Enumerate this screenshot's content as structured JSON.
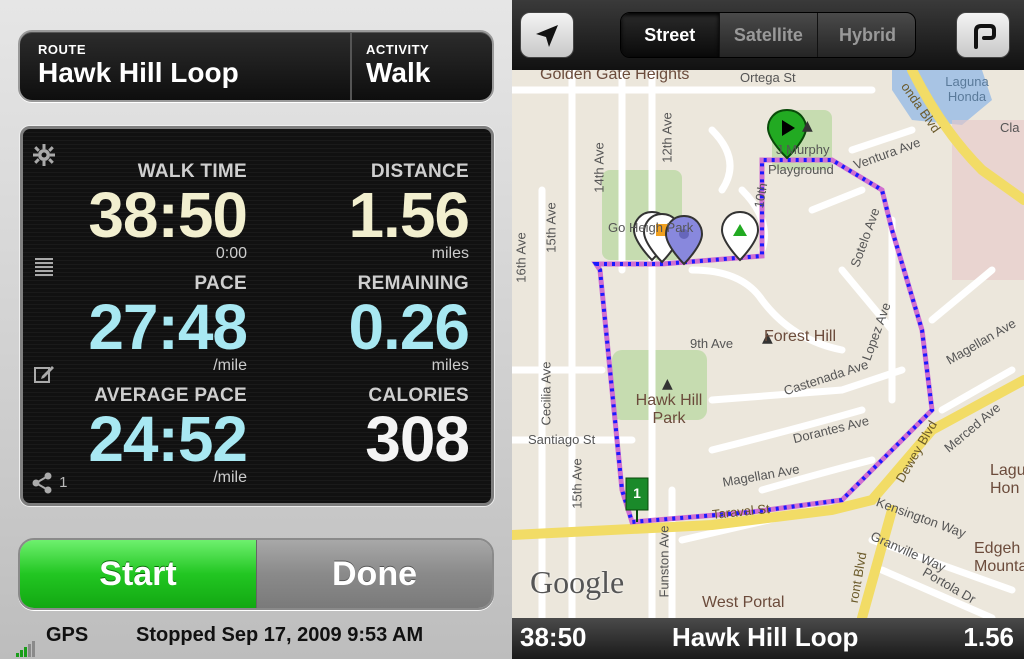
{
  "header": {
    "route_label": "ROUTE",
    "route_value": "Hawk Hill Loop",
    "activity_label": "ACTIVITY",
    "activity_value": "Walk"
  },
  "stats": {
    "walk_time": {
      "label": "WALK TIME",
      "value": "38:50",
      "sub": "0:00"
    },
    "distance": {
      "label": "DISTANCE",
      "value": "1.56",
      "sub": "miles"
    },
    "pace": {
      "label": "PACE",
      "value": "27:48",
      "sub": "/mile"
    },
    "remaining": {
      "label": "REMAINING",
      "value": "0.26",
      "sub": "miles"
    },
    "average_pace": {
      "label": "AVERAGE PACE",
      "value": "24:52",
      "sub": "/mile"
    },
    "calories": {
      "label": "CALORIES",
      "value": "308",
      "sub": ""
    }
  },
  "side_icons": {
    "share_count": "1"
  },
  "buttons": {
    "start_label": "Start",
    "done_label": "Done"
  },
  "status": {
    "gps_label": "GPS",
    "stopped_text": "Stopped Sep 17, 2009 9:53 AM"
  },
  "map_toolbar": {
    "tabs": [
      {
        "label": "Street",
        "active": true
      },
      {
        "label": "Satellite",
        "active": false
      },
      {
        "label": "Hybrid",
        "active": false
      }
    ]
  },
  "map_labels": {
    "golden_gate_heights": "Golden Gate Heights",
    "ortega": "Ortega St",
    "laguna_honda": "Laguna Honda",
    "fourteenth_ave": "14th Ave",
    "twelfth_ave": "12th Ave",
    "fifteenth_ave": "15th Ave",
    "sixteenth_ave": "16th Ave",
    "go_heights_park": "Go Heigh  Park",
    "jp_murphy": "J  Murphy",
    "playground": "Playground",
    "ventura": "Ventura Ave",
    "tenth_ave": "10th",
    "sotelo": "Sotelo Ave",
    "forest_hill": "Forest Hill",
    "ninth_ave": "9th Ave",
    "lopez": "Lopez Ave",
    "magellan_top": "Magellan Ave",
    "castenada": "Castenada Ave",
    "hawk_hill_park": "Hawk Hill Park",
    "cecilia": "Cecilia Ave",
    "santiago": "Santiago St",
    "fifteenth_ave_lower": "15th Ave",
    "dorantes": "Dorantes Ave",
    "merced": "Merced Ave",
    "magellan": "Magellan Ave",
    "dewey": "Dewey Blvd",
    "taraval": "Taraval St",
    "kensington": "Kensington Way",
    "granville": "Granville Way",
    "edgeh_mounta": "Edgeh Mounta",
    "lagu_hon": "Lagu Hon",
    "funston": "Funston Ave",
    "west_portal": "West Portal",
    "portola": "Portola Dr",
    "front_blvd": "ront Blvd",
    "honda_blvd": "onda Blvd",
    "clarendon": "Cla",
    "google": "Google"
  },
  "map_footer": {
    "time": "38:50",
    "route": "Hawk Hill Loop",
    "distance": "1.56"
  },
  "colors": {
    "start_green": "#22c622",
    "route_blue": "#1a1aff",
    "route_pink": "#d070d0",
    "value_yellow": "#f2efcf",
    "value_cyan": "#a8e8f2"
  }
}
